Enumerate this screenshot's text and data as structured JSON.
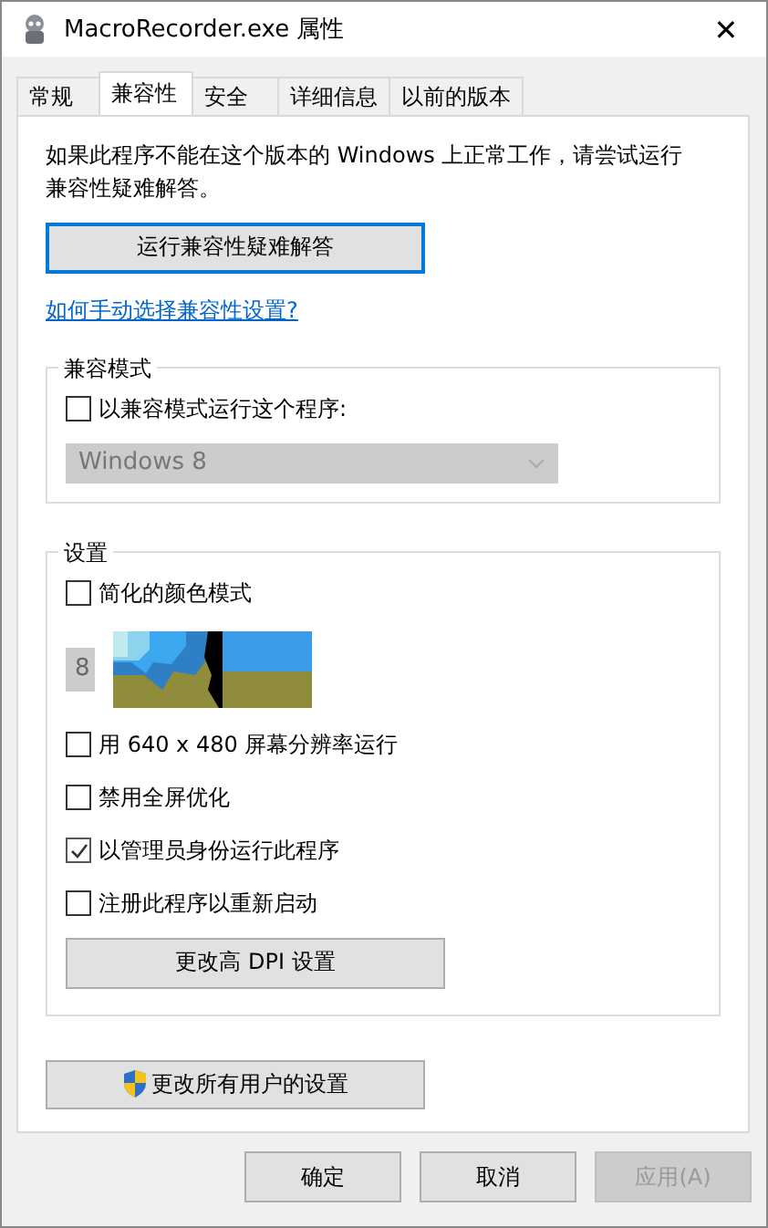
{
  "window": {
    "title": "MacroRecorder.exe 属性",
    "close": "✕"
  },
  "tabs": [
    {
      "label": "常规",
      "selected": false
    },
    {
      "label": "兼容性",
      "selected": true
    },
    {
      "label": "安全",
      "selected": false
    },
    {
      "label": "详细信息",
      "selected": false
    },
    {
      "label": "以前的版本",
      "selected": false
    }
  ],
  "intro": "如果此程序不能在这个版本的 Windows 上正常工作，请尝试运行兼容性疑难解答。",
  "troubleshoot_button": "运行兼容性疑难解答",
  "help_link": "如何手动选择兼容性设置?",
  "compat_mode": {
    "title": "兼容模式",
    "checkbox": {
      "label": "以兼容模式运行这个程序:",
      "checked": false
    },
    "dropdown": {
      "value": "Windows 8",
      "disabled": true
    }
  },
  "settings": {
    "title": "设置",
    "items": [
      {
        "kind": "checkbox",
        "label": "简化的颜色模式",
        "checked": false
      },
      {
        "kind": "dropdown",
        "value": "8",
        "disabled": true
      },
      {
        "kind": "checkbox",
        "label": "用 640 x 480 屏幕分辨率运行",
        "checked": false
      },
      {
        "kind": "checkbox",
        "label": "禁用全屏优化",
        "checked": false
      },
      {
        "kind": "checkbox",
        "label": "以管理员身份运行此程序",
        "checked": true
      },
      {
        "kind": "checkbox",
        "label": "注册此程序以重新启动",
        "checked": false
      }
    ],
    "dpi_button": "更改高 DPI 设置"
  },
  "all_users_button": "更改所有用户的设置",
  "buttons": [
    {
      "label": "确定",
      "disabled": false
    },
    {
      "label": "取消",
      "disabled": false
    },
    {
      "label": "应用(A)",
      "disabled": true
    }
  ]
}
